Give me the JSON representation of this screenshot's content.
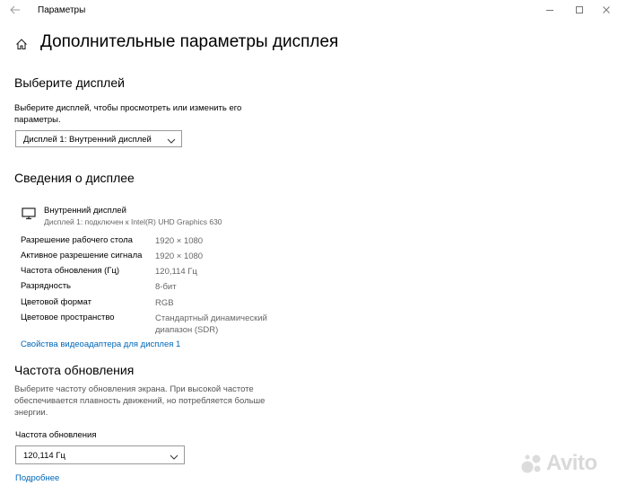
{
  "window": {
    "title": "Параметры",
    "back_icon": "arrow-left-icon",
    "minimize_icon": "minimize-icon",
    "maximize_icon": "maximize-icon",
    "close_icon": "close-icon"
  },
  "page": {
    "title": "Дополнительные параметры дисплея",
    "home_icon": "home-icon"
  },
  "select_display": {
    "heading": "Выберите дисплей",
    "description": "Выберите дисплей, чтобы просмотреть или изменить его параметры.",
    "selected": "Дисплей 1: Внутренний дисплей"
  },
  "display_info": {
    "heading": "Сведения о дисплее",
    "display_name": "Внутренний дисплей",
    "display_subtitle": "Дисплей 1: подключен к Intel(R) UHD Graphics 630",
    "rows": [
      {
        "label": "Разрешение рабочего стола",
        "value": "1920 × 1080"
      },
      {
        "label": "Активное разрешение сигнала",
        "value": "1920 × 1080"
      },
      {
        "label": "Частота обновления (Гц)",
        "value": "120,114 Гц"
      },
      {
        "label": "Разрядность",
        "value": "8-бит"
      },
      {
        "label": "Цветовой формат",
        "value": "RGB"
      },
      {
        "label": "Цветовое пространство",
        "value": "Стандартный динамический диапазон (SDR)"
      }
    ],
    "adapter_link": "Свойства видеоадаптера для дисплея 1"
  },
  "refresh_rate": {
    "heading": "Частота обновления",
    "description": "Выберите частоту обновления экрана. При высокой частоте обеспечивается плавность движений, но потребляется больше энергии.",
    "field_label": "Частота обновления",
    "selected": "120,114 Гц",
    "more_link": "Подробнее"
  },
  "watermark": {
    "text": "Avito"
  },
  "colors": {
    "link": "#0067b8",
    "secondary_text": "#666666"
  }
}
